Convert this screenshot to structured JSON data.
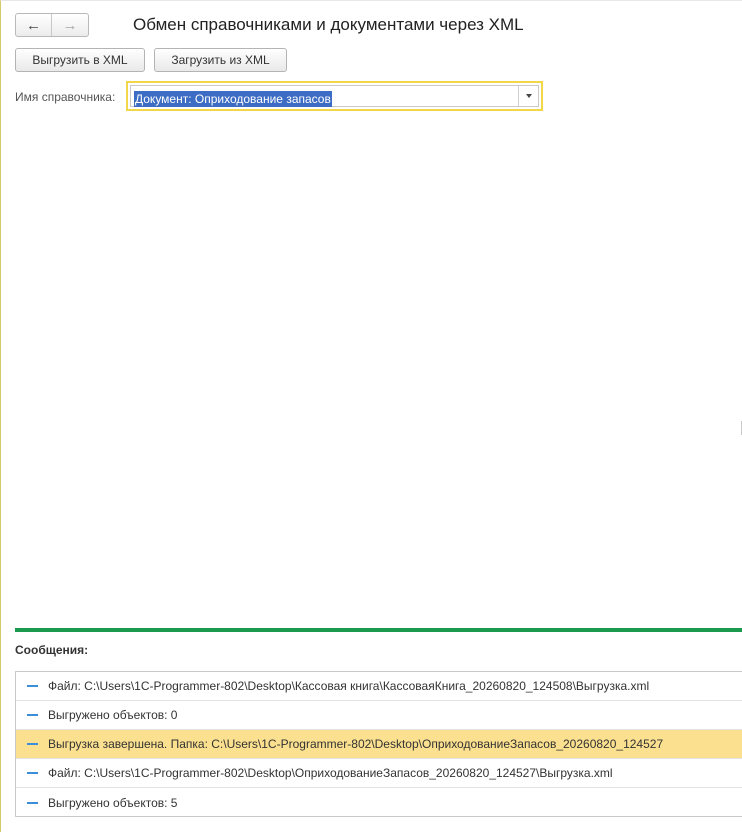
{
  "window": {
    "title": "Обмен справочниками и документами через XML"
  },
  "navigation": {
    "back_icon": "arrow-left",
    "forward_icon": "arrow-right"
  },
  "toolbar": {
    "export_label": "Выгрузить в XML",
    "import_label": "Загрузить из XML"
  },
  "catalog_field": {
    "label": "Имя справочника:",
    "value": "Документ: Оприходование запасов"
  },
  "messages": {
    "header": "Сообщения:",
    "items": [
      {
        "text": "Файл: C:\\Users\\1C-Programmer-802\\Desktop\\Кассовая книга\\КассоваяКнига_20260820_124508\\Выгрузка.xml",
        "highlighted": false
      },
      {
        "text": "Выгружено объектов: 0",
        "highlighted": false
      },
      {
        "text": "Выгрузка завершена. Папка: C:\\Users\\1C-Programmer-802\\Desktop\\ОприходованиеЗапасов_20260820_124527",
        "highlighted": true
      },
      {
        "text": "Файл: C:\\Users\\1C-Programmer-802\\Desktop\\ОприходованиеЗапасов_20260820_124527\\Выгрузка.xml",
        "highlighted": false
      },
      {
        "text": "Выгружено объектов: 5",
        "highlighted": false
      }
    ]
  },
  "colors": {
    "accent_green": "#1a9a4f",
    "focus_yellow": "#f2d74a",
    "highlight_row": "#fbe08f",
    "selection_blue": "#3d6cc4",
    "message_icon": "#3a8fd8"
  }
}
